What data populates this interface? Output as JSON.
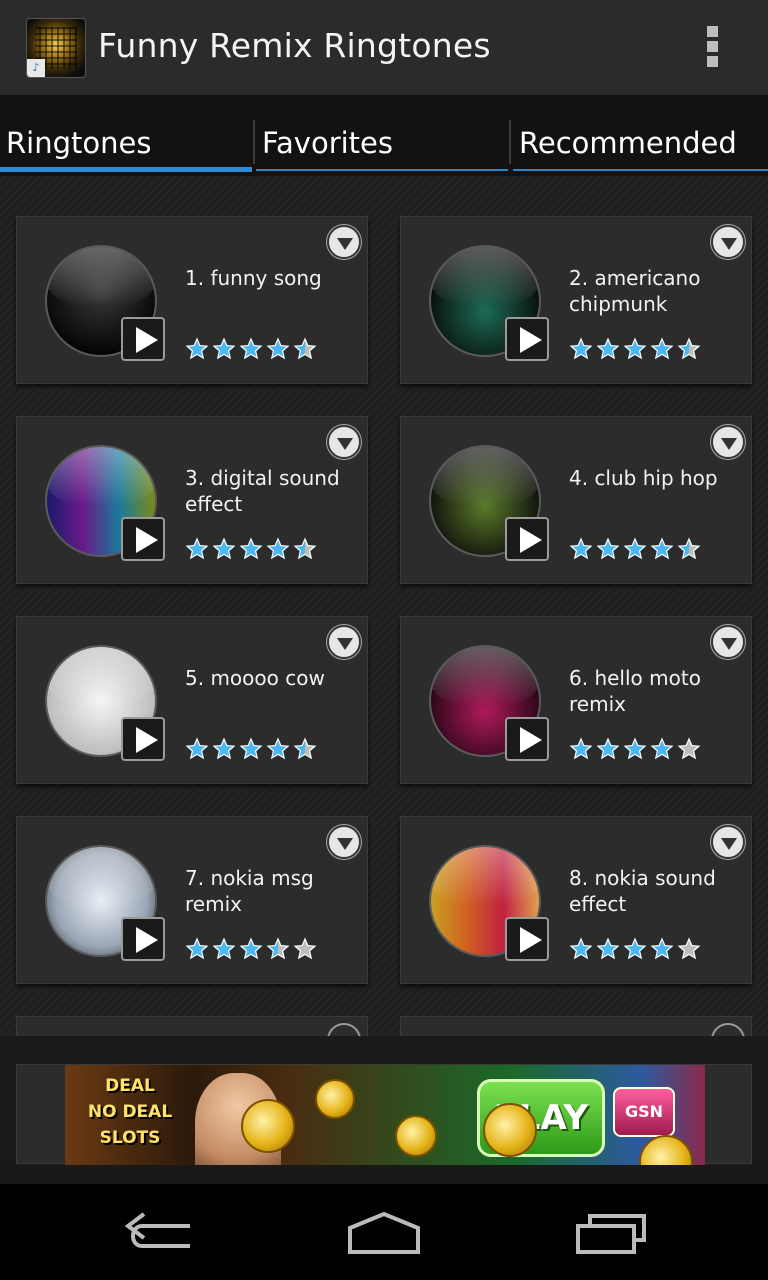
{
  "app": {
    "title": "Funny Remix Ringtones",
    "icon": "app-equalizer-icon",
    "overflow_icon": "overflow-menu-icon"
  },
  "tabs": [
    {
      "label": "Ringtones",
      "active": true
    },
    {
      "label": "Favorites",
      "active": false
    },
    {
      "label": "Recommended",
      "active": false
    }
  ],
  "ringtones": [
    {
      "name": "1. funny song",
      "rating": 4.5,
      "thumb": "music-note-icon"
    },
    {
      "name": "2. americano chipmunk",
      "rating": 4.5,
      "thumb": "green-waveform-icon"
    },
    {
      "name": "3. digital sound effect",
      "rating": 4.5,
      "thumb": "rainbow-waveform-icon"
    },
    {
      "name": "4. club hip hop",
      "rating": 4.5,
      "thumb": "light-swirl-icon"
    },
    {
      "name": "5. moooo cow",
      "rating": 4.5,
      "thumb": "cartoon-cow-icon"
    },
    {
      "name": "6. hello moto remix",
      "rating": 4,
      "thumb": "pink-waveform-icon"
    },
    {
      "name": "7. nokia msg remix",
      "rating": 3.5,
      "thumb": "cartoon-phone-icon"
    },
    {
      "name": "8. nokia sound effect",
      "rating": 4,
      "thumb": "dancers-icon"
    }
  ],
  "ad": {
    "logo_lines": [
      "DEAL",
      "NO DEAL",
      "SLOTS"
    ],
    "button": "PLAY NOW",
    "badge": "GSN"
  },
  "colors": {
    "accent": "#2f8bd6",
    "star": "#4db6ee",
    "star_empty": "#bdbdbd"
  },
  "navbar": {
    "icons": [
      "back-icon",
      "home-icon",
      "recent-apps-icon"
    ]
  }
}
